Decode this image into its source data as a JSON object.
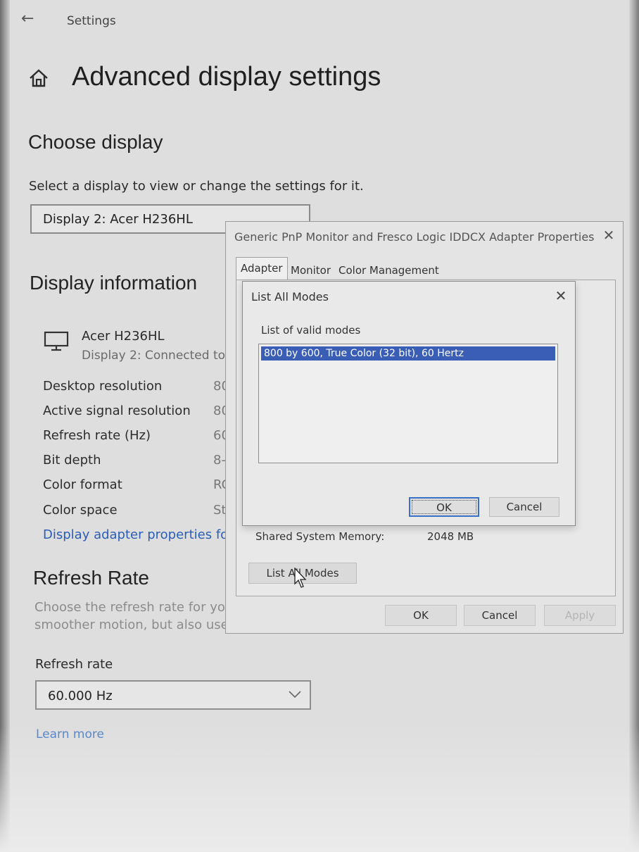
{
  "window": {
    "app_title": "Settings"
  },
  "page": {
    "title": "Advanced display settings"
  },
  "choose_display": {
    "heading": "Choose display",
    "description": "Select a display to view or change the settings for it.",
    "selected": "Display 2: Acer H236HL"
  },
  "display_info": {
    "heading": "Display information",
    "monitor_name": "Acer H236HL",
    "monitor_status": "Display 2: Connected to F",
    "rows": [
      {
        "label": "Desktop resolution",
        "value": "80"
      },
      {
        "label": "Active signal resolution",
        "value": "80"
      },
      {
        "label": "Refresh rate (Hz)",
        "value": "60"
      },
      {
        "label": "Bit depth",
        "value": "8-"
      },
      {
        "label": "Color format",
        "value": "RC"
      },
      {
        "label": "Color space",
        "value": "St"
      }
    ],
    "adapter_link": "Display adapter properties for"
  },
  "refresh": {
    "heading": "Refresh Rate",
    "description_line1": "Choose the refresh rate for you",
    "description_line2": "smoother motion, but also uses",
    "label": "Refresh rate",
    "selected": "60.000 Hz",
    "learn_more": "Learn more"
  },
  "properties_dialog": {
    "title": "Generic PnP Monitor and Fresco Logic IDDCX Adapter Properties",
    "close": "✕",
    "tabs": [
      "Adapter",
      "Monitor",
      "Color Management"
    ],
    "shared_memory_label": "Shared System Memory:",
    "shared_memory_value": "2048 MB",
    "list_all_modes": "List All Modes",
    "ok": "OK",
    "cancel": "Cancel",
    "apply": "Apply"
  },
  "modes_dialog": {
    "title": "List All Modes",
    "close": "✕",
    "list_label": "List of valid modes",
    "modes": [
      "800 by 600, True Color (32 bit), 60 Hertz"
    ],
    "ok": "OK",
    "cancel": "Cancel"
  },
  "colors": {
    "link": "#2a5db8",
    "selection": "#3a5db6",
    "focus_border": "#3b70c8"
  }
}
